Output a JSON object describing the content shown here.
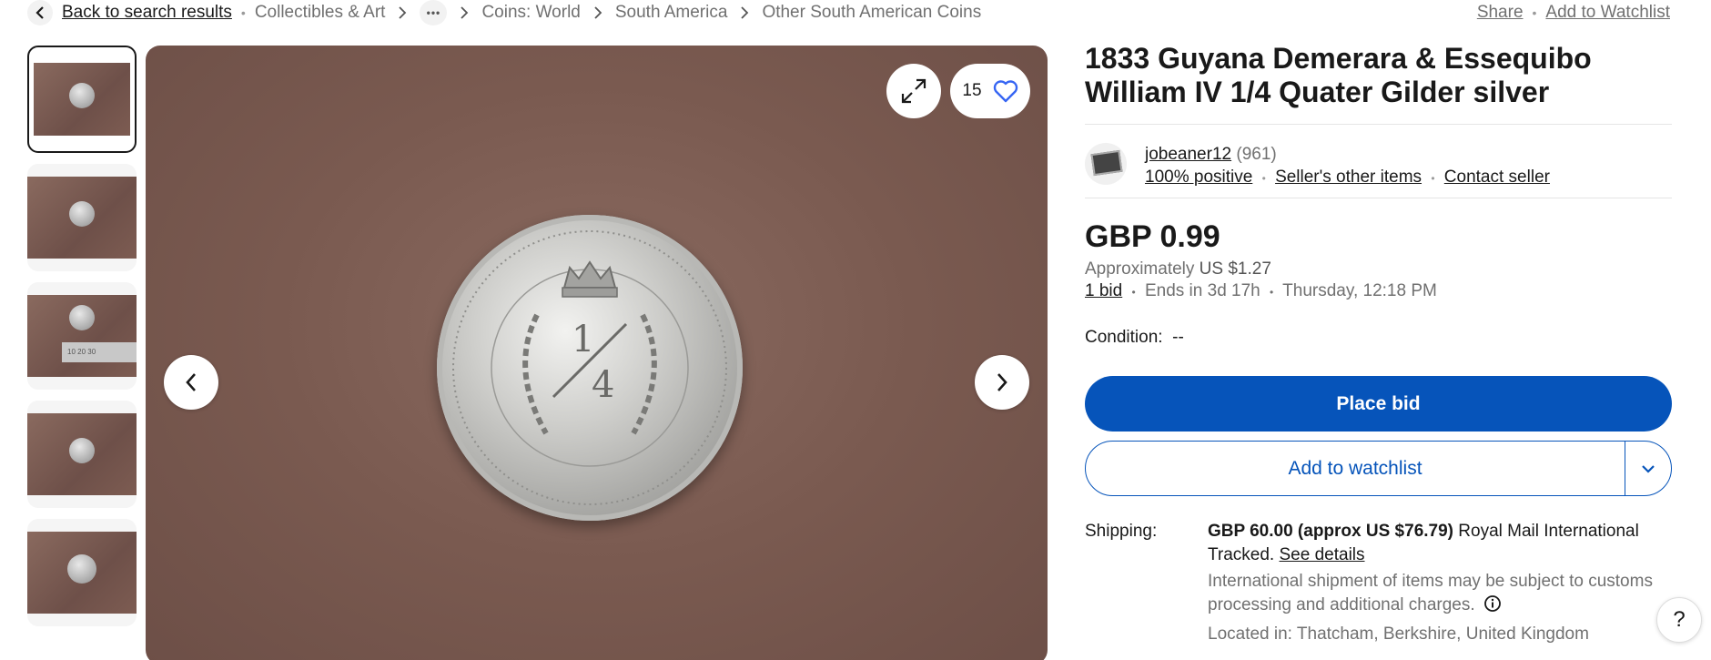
{
  "breadcrumb": {
    "back_label": "Back to search results",
    "items": [
      "Collectibles & Art",
      "Coins: World",
      "South America",
      "Other South American Coins"
    ],
    "more_label": "•••"
  },
  "top_actions": {
    "share": "Share",
    "watchlist": "Add to Watchlist"
  },
  "gallery": {
    "thumbnail_count": 5,
    "active_index": 0,
    "ruler_text": "10  20  30",
    "watch_count": "15"
  },
  "listing": {
    "title": "1833 Guyana Demerara & Essequibo William IV 1/4 Quater Gilder silver",
    "seller": {
      "name": "jobeaner12",
      "feedback_count": "(961)",
      "positive": "100% positive",
      "other_items": "Seller's other items",
      "contact": "Contact seller"
    },
    "price": "GBP 0.99",
    "approx_label": "Approximately",
    "approx_value": "US $1.27",
    "bids": "1 bid",
    "ends_in": "Ends in 3d 17h",
    "end_time": "Thursday, 12:18 PM",
    "condition_label": "Condition:",
    "condition_value": "--",
    "place_bid": "Place bid",
    "add_watchlist": "Add to watchlist",
    "shipping": {
      "label": "Shipping:",
      "cost": "GBP 60.00 (approx US $76.79)",
      "service": "Royal Mail International Tracked.",
      "see_details": "See details",
      "customs_note": "International shipment of items may be subject to customs processing and additional charges.",
      "location": "Located in: Thatcham, Berkshire, United Kingdom"
    }
  },
  "help_label": "?",
  "colors": {
    "primary": "#0654ba",
    "text": "#191919",
    "muted": "#707070",
    "heart": "#3665f3"
  },
  "icons": [
    "chevron-left-icon",
    "chevron-right-icon",
    "more-icon",
    "expand-icon",
    "heart-icon",
    "chevron-down-icon",
    "info-icon",
    "help-icon"
  ]
}
